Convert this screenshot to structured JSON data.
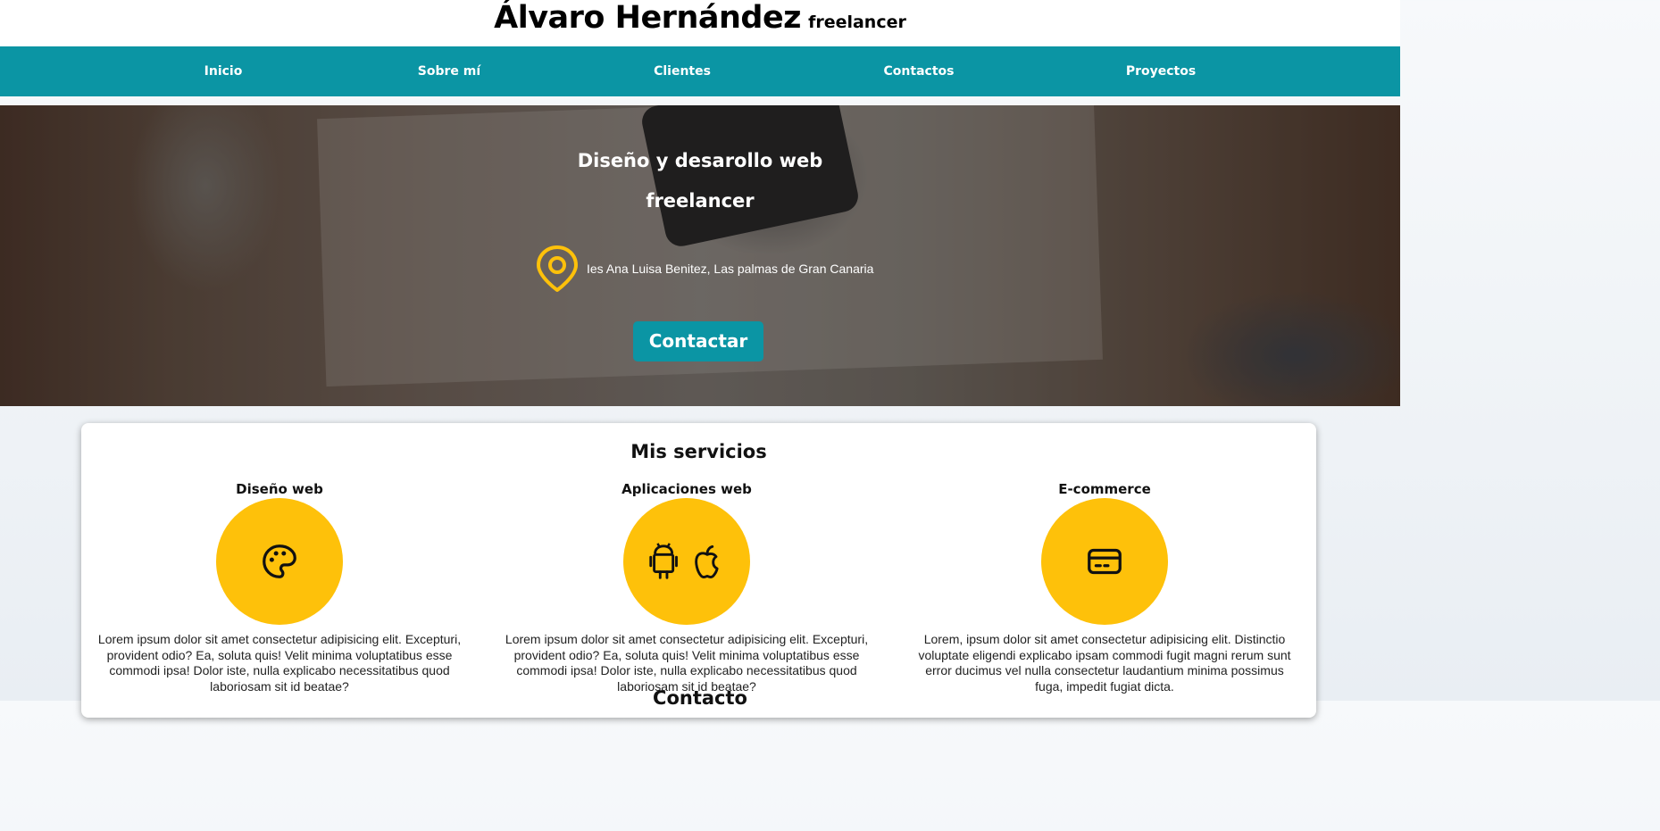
{
  "header": {
    "name": "Álvaro Hernández",
    "role": "freelancer"
  },
  "nav": {
    "items": [
      "Inicio",
      "Sobre mí",
      "Clientes",
      "Contactos",
      "Proyectos"
    ]
  },
  "hero": {
    "heading_line1": "Diseño y desarollo web",
    "heading_line2": "freelancer",
    "location": "Ies Ana Luisa Benitez, Las palmas de Gran Canaria",
    "location_icon": "map-pin-icon",
    "button_label": "Contactar"
  },
  "services": {
    "title": "Mis servicios",
    "items": [
      {
        "title": "Diseño web",
        "icon": "palette-icon",
        "text": "Lorem ipsum dolor sit amet consectetur adipisicing elit. Excepturi, provident odio? Ea, soluta quis! Velit minima voluptatibus esse commodi ipsa! Dolor iste, nulla explicabo necessitatibus quod laboriosam sit id beatae?"
      },
      {
        "title": "Aplicaciones web",
        "icon": "android-apple-icon",
        "text": "Lorem ipsum dolor sit amet consectetur adipisicing elit. Excepturi, provident odio? Ea, soluta quis! Velit minima voluptatibus esse commodi ipsa! Dolor iste, nulla explicabo necessitatibus quod laboriosam sit id beatae?"
      },
      {
        "title": "E-commerce",
        "icon": "credit-card-icon",
        "text": "Lorem, ipsum dolor sit amet consectetur adipisicing elit. Distinctio voluptate eligendi explicabo ipsam commodi fugit magni rerum sunt error ducimus vel nulla consectetur laudantium minima possimus fuga, impedit fugiat dicta."
      }
    ]
  },
  "contact": {
    "title": "Contacto"
  },
  "colors": {
    "accent": "#0b95a4",
    "highlight": "#fec10a"
  }
}
